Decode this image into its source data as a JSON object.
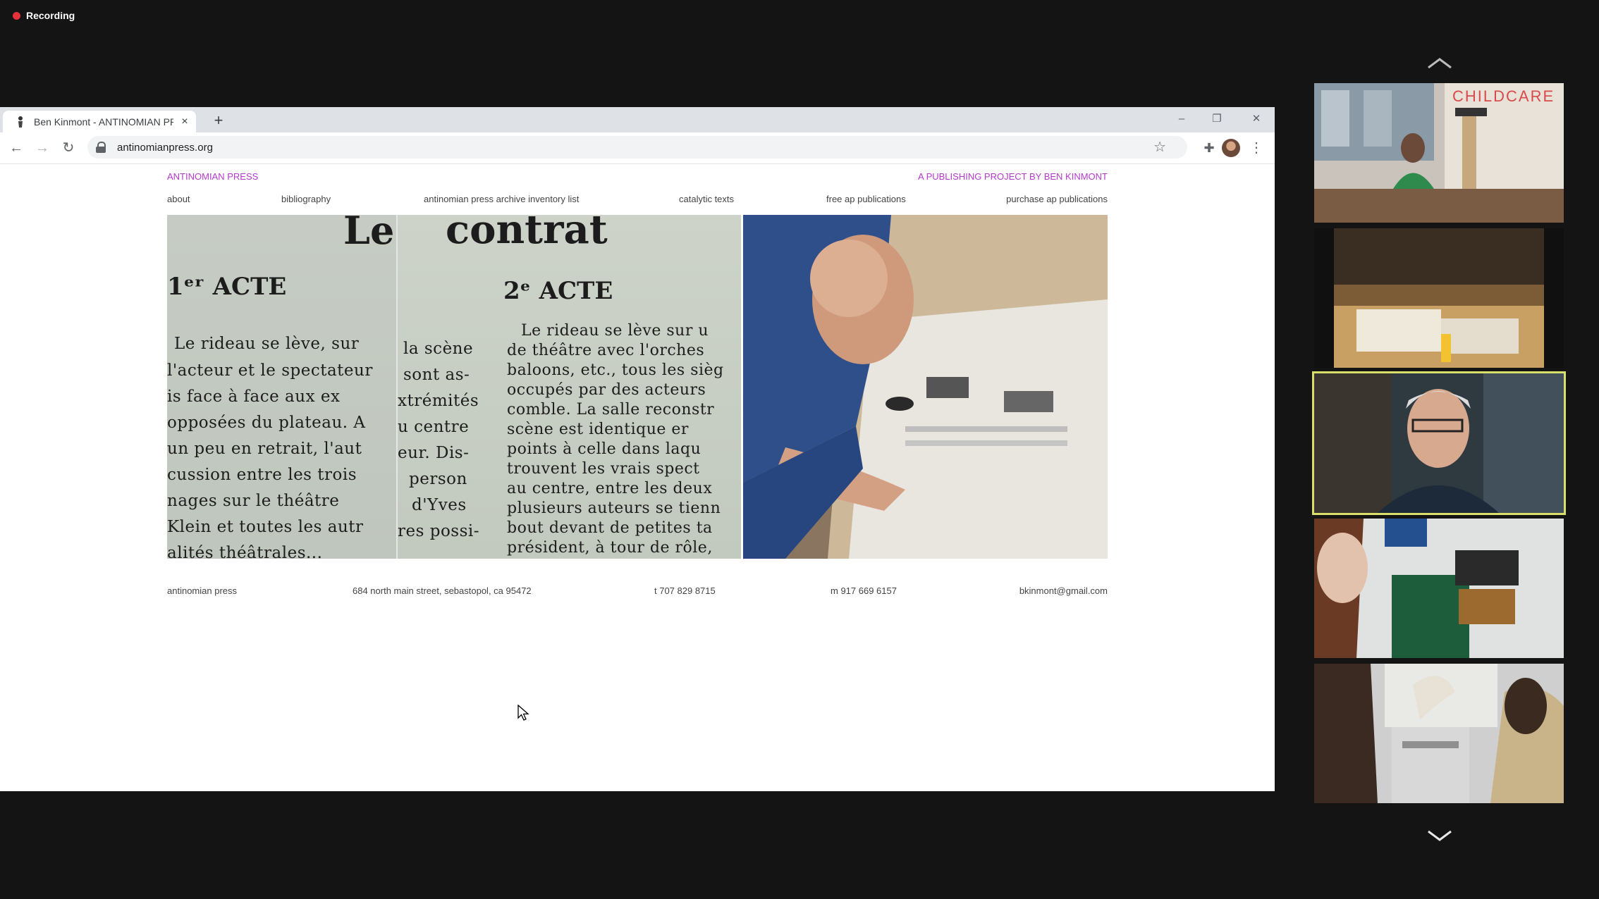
{
  "recording": {
    "label": "Recording",
    "color": "#e5323a"
  },
  "browser": {
    "tab_title": "Ben Kinmont - ANTINOMIAN PRESS",
    "tab_close_glyph": "×",
    "new_tab_glyph": "+",
    "url": "antinomianpress.org",
    "controls": {
      "minimize": "–",
      "restore": "❐",
      "close": "✕"
    }
  },
  "site": {
    "title": "ANTINOMIAN PRESS",
    "subtitle": "A PUBLISHING PROJECT BY BEN KINMONT",
    "accent_color": "#b33acb",
    "nav": [
      {
        "label": "about"
      },
      {
        "label": "bibliography"
      },
      {
        "label": "antinomian press archive inventory list"
      },
      {
        "label": "catalytic texts"
      },
      {
        "label": "free ap publications"
      },
      {
        "label": "purchase ap publications"
      }
    ],
    "hero": {
      "heading_word": "Le contrat",
      "heading_fragment_a": "Le",
      "heading_fragment_b": "contrat",
      "act1": "1ᵉʳ ACTE",
      "act2": "2ᵉ ACTE",
      "col1_lines": [
        "Le rideau se lève, sur",
        "l'acteur et le spectateur",
        "is face à face aux ex",
        "opposées du plateau. A",
        "un peu en retrait, l'aut",
        "cussion entre les trois",
        "nages sur le théâtre",
        "Klein et toutes les autr",
        "alités théâtrales..."
      ],
      "col2a_lines": [
        "la scène",
        "sont as-",
        "xtrémités",
        "u centre",
        "eur. Dis-",
        "person",
        "d'Yves",
        "res possi-"
      ],
      "col2b_lines": [
        "Le rideau se lève sur u",
        "de théâtre avec l'orches",
        "baloons, etc., tous les sièg",
        "occupés par des acteurs",
        "comble. La salle reconstr",
        "scène est identique er",
        "points à celle dans laqu",
        "trouvent les vrais spect",
        "au centre, entre les deux",
        "plusieurs auteurs se tienn",
        "bout devant de petites ta",
        "président, à tour de rôle,"
      ]
    },
    "footer": {
      "name": "antinomian press",
      "address": "684 north main street, sebastopol, ca 95472",
      "phone": "t 707 829 8715",
      "mobile": "m 917 669 6157",
      "email": "bkinmont@gmail.com"
    }
  },
  "participants": {
    "scroll_up_icon": "chevron-up-icon",
    "scroll_down_icon": "chevron-down-icon",
    "tiles": [
      {
        "name": "participant-childcare",
        "sign": "CHILDCARE"
      },
      {
        "name": "participant-desk"
      },
      {
        "name": "participant-speaker",
        "active": true,
        "highlight_color": "#d8e06a"
      },
      {
        "name": "participant-printer-room"
      },
      {
        "name": "participant-office"
      }
    ]
  }
}
